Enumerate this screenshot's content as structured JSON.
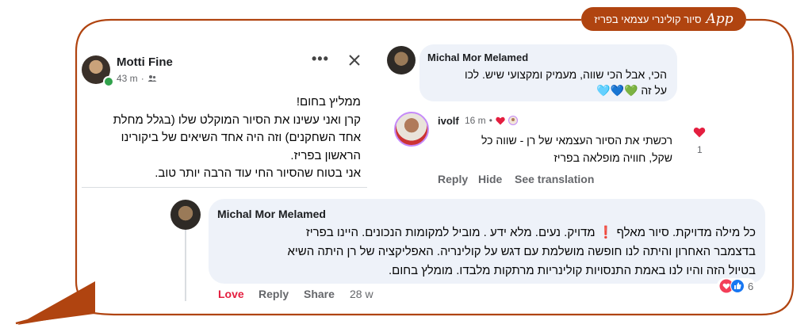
{
  "tag": {
    "app_word": "App",
    "title": "סיור קולינרי עצמאי בפריז"
  },
  "post": {
    "author": "Motti Fine",
    "meta_time": "43 m",
    "body_lines": [
      "ממליץ בחום!",
      "קרן ואני עשינו את הסיור המוקלט שלו (בגלל מחלת",
      "אחד השחקנים) וזה היה אחד השיאים של ביקורינו",
      "הראשון בפריז.",
      "אני בטוח שהסיור החי עוד הרבה יותר טוב."
    ],
    "more_icon": "more-dots-icon",
    "close_icon": "close-x-icon"
  },
  "comment1": {
    "author": "Michal Mor Melamed",
    "lines": [
      "הכי, אבל הכי שווה, מעמיק ומקצועי שיש. לכו",
      "על זה 💚💙🩵"
    ]
  },
  "comment2": {
    "author": "ivolf",
    "time": "16 m",
    "lines": [
      "רכשתי את הסיור העצמאי של רן - שווה כל",
      "שקל, חוויה מופלאה בפריז"
    ],
    "like_count": "1",
    "actions": {
      "reply": "Reply",
      "hide": "Hide",
      "translate": "See translation"
    }
  },
  "comment3": {
    "author": "Michal Mor Melamed",
    "lines": [
      "כל מילה מדויקת. סיור מאלף ❗ מדויק. נעים. מלא ידע . מוביל למקומות הנכונים. היינו בפריז",
      "בדצמבר האחרון והיתה לנו חופשה מושלמת עם דגש על קולינריה. האפליקציה של רן היתה השיא",
      "בטיול הזה והיו לנו באמת התנסויות קולינריות מרתקות מלבדו. מומלץ בחום."
    ],
    "reaction_count": "6",
    "actions": {
      "love": "Love",
      "reply": "Reply",
      "share": "Share",
      "time": "28 w"
    }
  },
  "colors": {
    "frame": "#b04410",
    "love": "#e41e3f",
    "bubble": "#eef2f9"
  }
}
